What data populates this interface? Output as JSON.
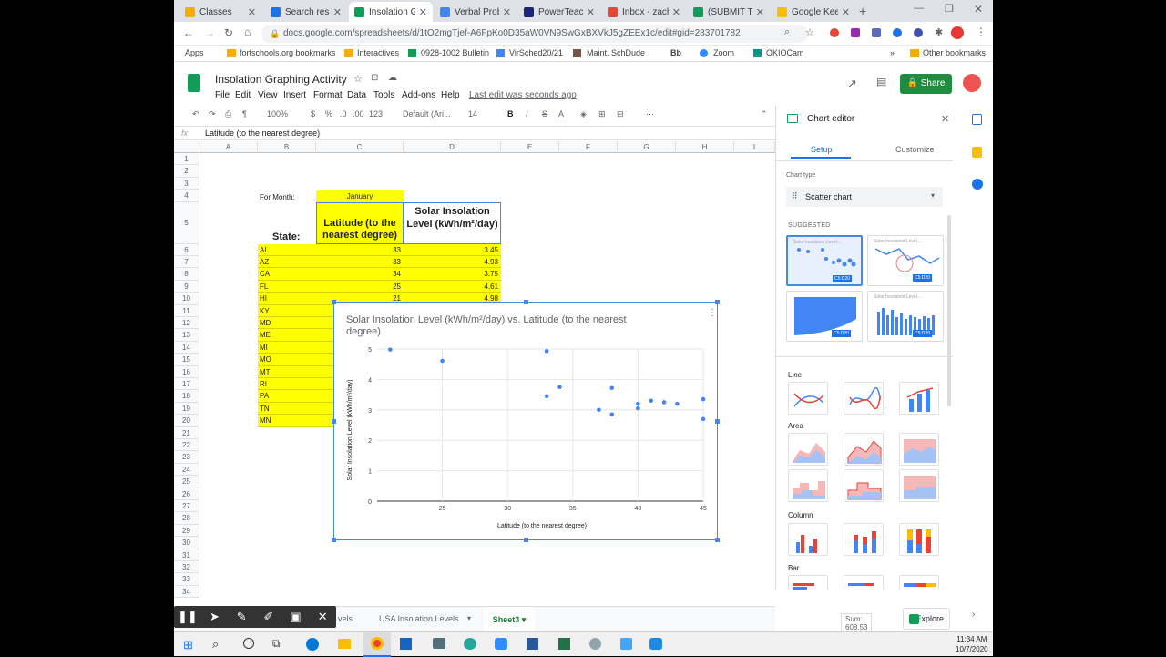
{
  "browser": {
    "tabs": [
      {
        "label": "Classes",
        "color": "#f9ab00"
      },
      {
        "label": "Search resul",
        "color": "#1a73e8"
      },
      {
        "label": "Insolation G",
        "color": "#0f9d58"
      },
      {
        "label": "Verbal Probl",
        "color": "#4285f4"
      },
      {
        "label": "PowerTeach",
        "color": "#1a237e"
      },
      {
        "label": "Inbox - zach",
        "color": "#ea4335"
      },
      {
        "label": "(SUBMIT TH",
        "color": "#0f9d58"
      },
      {
        "label": "Google Keep",
        "color": "#fbbc04"
      }
    ],
    "url": "docs.google.com/spreadsheets/d/1tO2mgTjef-A6FpKo0D35aW0VN9SwGxBXVkJ5gZEEx1c/edit#gid=283701782",
    "bookmarks": [
      "Apps",
      "fortschools.org bookmarks",
      "Interactives",
      "0928-1002 Bulletin",
      "VirSched20/21",
      "Maint. SchDude",
      "Bb",
      "Zoom",
      "OKIOCam"
    ],
    "other_bookmarks": "Other bookmarks"
  },
  "doc": {
    "title": "Insolation Graphing Activity",
    "menu": [
      "File",
      "Edit",
      "View",
      "Insert",
      "Format",
      "Data",
      "Tools",
      "Add-ons",
      "Help"
    ],
    "last_edit": "Last edit was seconds ago",
    "share_label": "Share"
  },
  "toolbar": {
    "zoom": "100%",
    "currency": "$",
    "percent": "%",
    "dec1": ".0",
    "dec2": ".00",
    "more_formats": "123",
    "font": "Default (Ari...",
    "font_size": "14",
    "bold": "B",
    "italic": "I",
    "strike": "S",
    "text_color": "A"
  },
  "formula_bar": {
    "fx": "fx",
    "content": "Latitude (to the nearest degree)"
  },
  "columns": [
    "A",
    "B",
    "C",
    "D",
    "E",
    "F",
    "G",
    "H",
    "I"
  ],
  "rows": [
    "1",
    "2",
    "3",
    "4",
    "5",
    "6",
    "7",
    "8",
    "9",
    "10",
    "11",
    "12",
    "13",
    "14",
    "15",
    "16",
    "17",
    "18",
    "19",
    "20",
    "21",
    "22",
    "23",
    "24",
    "25",
    "26",
    "27",
    "28",
    "29",
    "30",
    "31",
    "32",
    "33",
    "34"
  ],
  "sheet": {
    "for_month_label": "For Month:",
    "month": "January",
    "state_header": "State:",
    "lat_header": "Latitude (to the nearest degree)",
    "solar_header": "Solar Insolation Level (kWh/m²/day)",
    "states": [
      "AL",
      "AZ",
      "CA",
      "FL",
      "HI",
      "KY",
      "MD",
      "ME",
      "MI",
      "MO",
      "MT",
      "RI",
      "PA",
      "TN",
      "MN"
    ],
    "lats": [
      "33",
      "33",
      "34",
      "25",
      "21"
    ],
    "solar": [
      "3.45",
      "4.93",
      "3.75",
      "4.61",
      "4.98"
    ]
  },
  "chart_data": {
    "type": "scatter",
    "title": "Solar Insolation Level (kWh/m²/day) vs. Latitude (to the nearest degree)",
    "xlabel": "Latitude (to the nearest degree)",
    "ylabel": "Solar Insolation Level (kWh/m²/day)",
    "xlim": [
      20,
      45
    ],
    "ylim": [
      0,
      5
    ],
    "xticks": [
      25,
      30,
      35,
      40,
      45
    ],
    "yticks": [
      0,
      1,
      2,
      3,
      4,
      5
    ],
    "grid": true,
    "points": [
      {
        "x": 21,
        "y": 4.98
      },
      {
        "x": 25,
        "y": 4.61
      },
      {
        "x": 33,
        "y": 4.93
      },
      {
        "x": 33,
        "y": 3.45
      },
      {
        "x": 34,
        "y": 3.75
      },
      {
        "x": 37,
        "y": 3.0
      },
      {
        "x": 38,
        "y": 3.72
      },
      {
        "x": 38,
        "y": 2.85
      },
      {
        "x": 40,
        "y": 3.2
      },
      {
        "x": 40,
        "y": 3.05
      },
      {
        "x": 41,
        "y": 3.3
      },
      {
        "x": 42,
        "y": 3.25
      },
      {
        "x": 43,
        "y": 3.2
      },
      {
        "x": 45,
        "y": 3.35
      },
      {
        "x": 45,
        "y": 2.7
      }
    ],
    "color": "#4285f4"
  },
  "sheet_tabs": [
    "vels",
    "USA Insolation Levels",
    "Sheet3"
  ],
  "sum_label": "Sum: 608.53",
  "explore_label": "Explore",
  "editor": {
    "title": "Chart editor",
    "tab_setup": "Setup",
    "tab_customize": "Customize",
    "chart_type_label": "Chart type",
    "chart_type_value": "Scatter chart",
    "suggested": "SUGGESTED",
    "thumb_title": "Solar Insolation Level...",
    "thumb_badge": "C5:D20",
    "line": "Line",
    "area": "Area",
    "column": "Column",
    "bar": "Bar"
  },
  "taskbar": {
    "time": "11:34 AM",
    "date": "10/7/2020"
  },
  "colors": {
    "accent": "#4a86e8",
    "share": "#1e8e3e",
    "highlight": "#ffff00"
  }
}
